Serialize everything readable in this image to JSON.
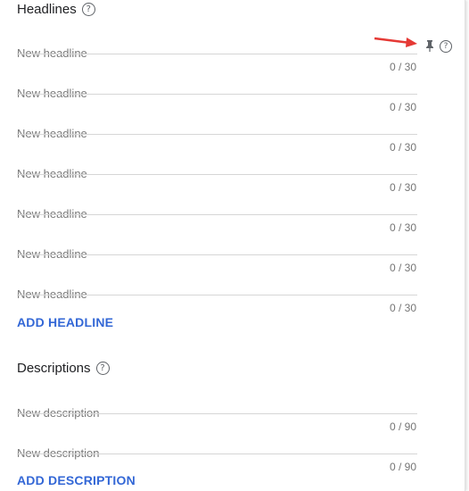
{
  "headlines": {
    "title": "Headlines",
    "help_glyph": "?",
    "placeholder": "New headline",
    "counters": [
      "0 / 30",
      "0 / 30",
      "0 / 30",
      "0 / 30",
      "0 / 30",
      "0 / 30",
      "0 / 30"
    ],
    "add_label": "ADD HEADLINE",
    "pin_icon": "pin-icon"
  },
  "descriptions": {
    "title": "Descriptions",
    "help_glyph": "?",
    "placeholder": "New description",
    "counters": [
      "0 / 90",
      "0 / 90"
    ],
    "add_label": "ADD DESCRIPTION"
  },
  "annotation": {
    "arrow_color": "#e53935"
  },
  "colors": {
    "accent": "#3367d6"
  }
}
